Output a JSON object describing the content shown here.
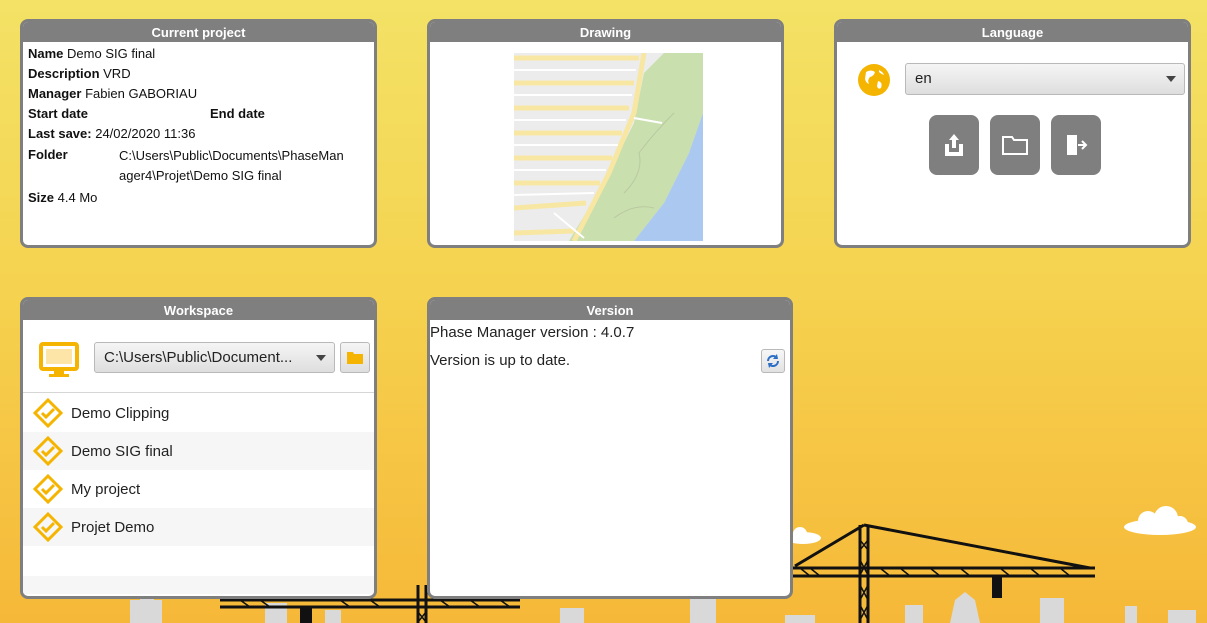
{
  "colors": {
    "panel_border": "#7f7f7f",
    "accent_yellow": "#f5b400",
    "sky_top": "#f3e266",
    "sky_bottom": "#f6b838"
  },
  "current_project": {
    "title": "Current project",
    "name_label": "Name",
    "name_value": "Demo SIG final",
    "description_label": "Description",
    "description_value": "VRD",
    "manager_label": "Manager",
    "manager_value": "Fabien GABORIAU",
    "start_date_label": "Start date",
    "end_date_label": "End date",
    "last_save_label": "Last save:",
    "last_save_value": "24/02/2020 11:36",
    "folder_label": "Folder",
    "folder_value_line1": "C:\\Users\\Public\\Documents\\PhaseMan",
    "folder_value_line2": "ager4\\Projet\\Demo SIG final",
    "size_label": "Size",
    "size_value": "4.4 Mo"
  },
  "drawing": {
    "title": "Drawing",
    "map_thumbnail_icon": "map-thumbnail"
  },
  "language": {
    "title": "Language",
    "selected": "en",
    "globe_icon": "globe-icon",
    "buttons": [
      {
        "icon": "upload-icon"
      },
      {
        "icon": "folder-icon"
      },
      {
        "icon": "exit-icon"
      }
    ]
  },
  "workspace": {
    "title": "Workspace",
    "monitor_icon": "monitor-icon",
    "path_value": "C:\\Users\\Public\\Document...",
    "browse_icon": "folder-icon",
    "projects": [
      "Demo Clipping",
      "Demo SIG final",
      "My project",
      "Projet Demo"
    ]
  },
  "version": {
    "title": "Version",
    "version_line": "Phase Manager version : 4.0.7",
    "status_line": "Version is up to date.",
    "refresh_icon": "refresh-icon"
  }
}
